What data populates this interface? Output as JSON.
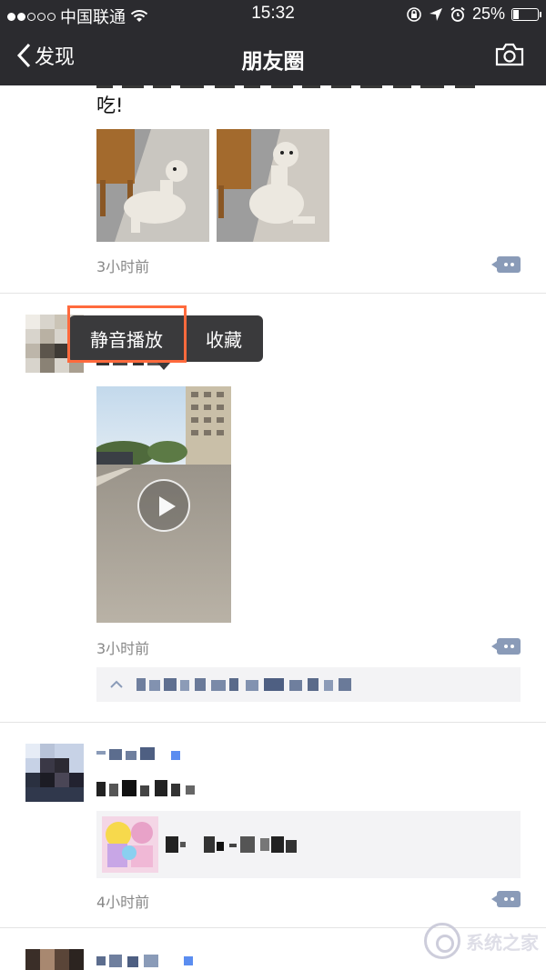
{
  "status_bar": {
    "carrier": "中国联通",
    "time": "15:32",
    "battery": "25%",
    "battery_level": 0.25
  },
  "nav": {
    "back_label": "发现",
    "title": "朋友圈"
  },
  "posts": [
    {
      "text_cont": "吃!",
      "time": "3小时前"
    },
    {
      "time": "3小时前"
    },
    {
      "time": "4小时前"
    }
  ],
  "popup": {
    "mute_play": "静音播放",
    "favorite": "收藏"
  },
  "watermark": "系统之家",
  "colors": {
    "bar_background": "#2b2b2f",
    "highlight": "#ff6a3d",
    "comment_button": "#8a9bb8"
  }
}
